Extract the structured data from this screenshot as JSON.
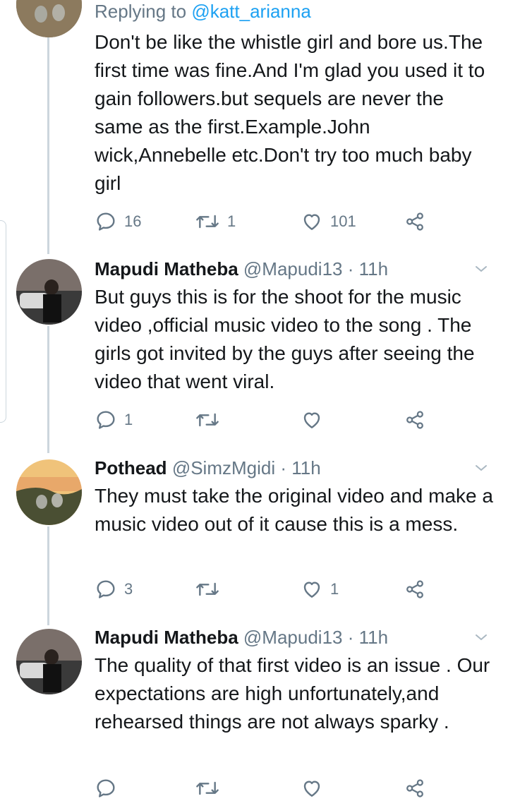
{
  "colors": {
    "accent": "#1da1f2",
    "muted": "#657786",
    "text": "#14171a",
    "line": "#ccd6dd"
  },
  "tweets": [
    {
      "replying_prefix": "Replying to",
      "replying_to": "@katt_arianna",
      "text": "Don't be like the whistle girl and bore us.The first time was fine.And I'm glad you used it to gain followers.but sequels are never the same as the first.Example.John wick,Annebelle etc.Don't try too much baby girl",
      "replies": "16",
      "retweets": "1",
      "likes": "101"
    },
    {
      "name": "Mapudi Matheba",
      "handle": "@Mapudi13",
      "time": "· 11h",
      "text": "But guys this is for the shoot for the music video ,official music video to the song . The girls got invited by the guys after seeing the video that went viral.",
      "replies": "1",
      "retweets": "",
      "likes": ""
    },
    {
      "name": "Pothead",
      "handle": "@SimzMgidi",
      "time": "· 11h",
      "text": "They must take the original video and make a music video out of it cause this is a mess.",
      "replies": "3",
      "retweets": "",
      "likes": "1"
    },
    {
      "name": "Mapudi Matheba",
      "handle": "@Mapudi13",
      "time": "· 11h",
      "text": "The quality of that first video is an issue . Our expectations are high unfortunately,and rehearsed things are not always sparky .",
      "replies": "",
      "retweets": "",
      "likes": ""
    }
  ],
  "icons": {
    "reply": "reply-icon",
    "retweet": "retweet-icon",
    "like": "heart-icon",
    "share": "share-icon",
    "caret": "chevron-down-icon"
  }
}
